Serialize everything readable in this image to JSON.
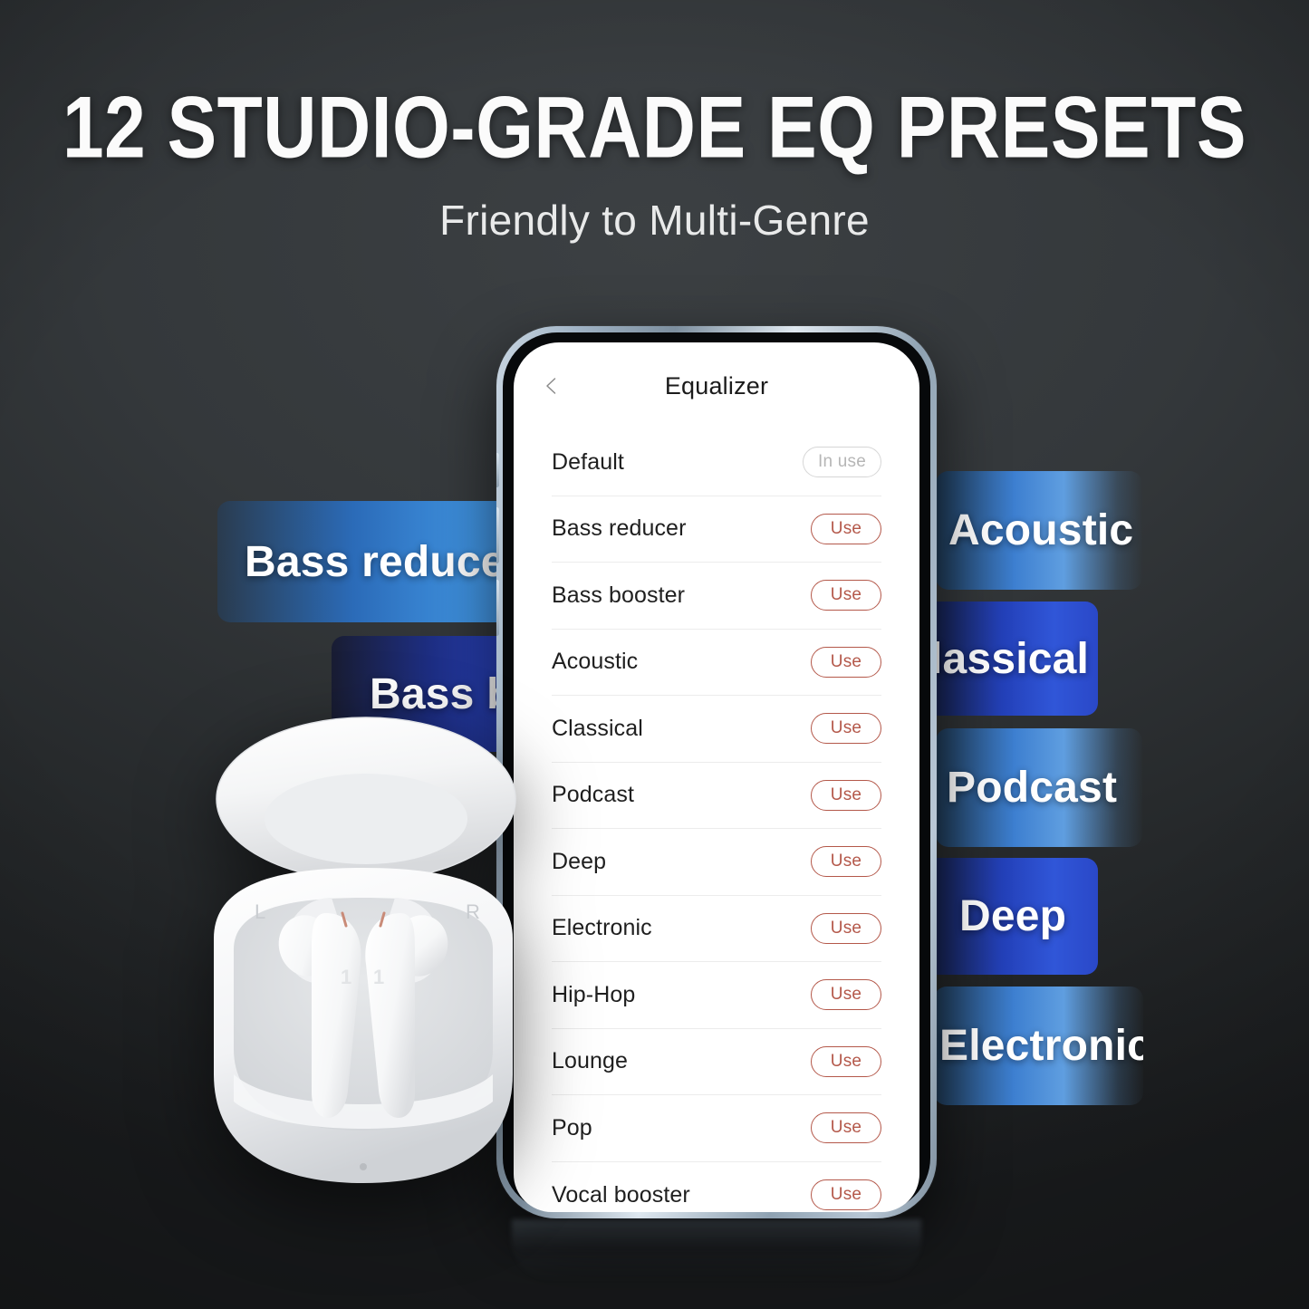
{
  "headline": "12 STUDIO-GRADE EQ PRESETS",
  "subheadline": "Friendly to Multi-Genre",
  "colors": {
    "background_top": "#3c4043",
    "background_bottom": "#1b1d1f",
    "accent_use": "#b4584a",
    "accent_inuse": "#b6b6b6",
    "card_blue_light": "#3d7fd0",
    "card_blue_dark": "#2340b8",
    "phone_frame": "#9fb2c4"
  },
  "phone": {
    "app": {
      "back_icon": "chevron-left-icon",
      "title": "Equalizer",
      "presets": [
        {
          "name": "Default",
          "action": "In use",
          "state": "in-use"
        },
        {
          "name": "Bass reducer",
          "action": "Use",
          "state": "available"
        },
        {
          "name": "Bass booster",
          "action": "Use",
          "state": "available"
        },
        {
          "name": "Acoustic",
          "action": "Use",
          "state": "available"
        },
        {
          "name": "Classical",
          "action": "Use",
          "state": "available"
        },
        {
          "name": "Podcast",
          "action": "Use",
          "state": "available"
        },
        {
          "name": "Deep",
          "action": "Use",
          "state": "available"
        },
        {
          "name": "Electronic",
          "action": "Use",
          "state": "available"
        },
        {
          "name": "Hip-Hop",
          "action": "Use",
          "state": "available"
        },
        {
          "name": "Lounge",
          "action": "Use",
          "state": "available"
        },
        {
          "name": "Pop",
          "action": "Use",
          "state": "available"
        },
        {
          "name": "Vocal booster",
          "action": "Use",
          "state": "available"
        }
      ]
    }
  },
  "floating_cards_left": [
    {
      "label": "Bass reducer",
      "style": "light"
    },
    {
      "label": "Bass b",
      "style": "dark"
    }
  ],
  "floating_cards_right": [
    {
      "label": "Acoustic",
      "style": "light"
    },
    {
      "label": "lassical",
      "style": "dark"
    },
    {
      "label": "Podcast",
      "style": "light"
    },
    {
      "label": "Deep",
      "style": "dark"
    },
    {
      "label": "Electronic",
      "style": "light"
    }
  ],
  "product": {
    "name": "earbuds-charging-case",
    "left_marker": "L",
    "right_marker": "R"
  }
}
